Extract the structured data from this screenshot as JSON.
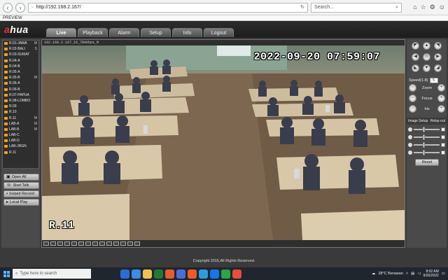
{
  "browser": {
    "url": "http://192.168.2.167/",
    "search_placeholder": "Search...",
    "tab_title": "PREVIEW"
  },
  "app": {
    "logo_prefix": "a",
    "logo_main": "hua",
    "tabs": [
      {
        "label": "Live",
        "active": true
      },
      {
        "label": "Playback",
        "active": false
      },
      {
        "label": "Alarm",
        "active": false
      },
      {
        "label": "Setup",
        "active": false
      },
      {
        "label": "Info",
        "active": false
      },
      {
        "label": "Logout",
        "active": false
      }
    ]
  },
  "sidebar": {
    "cameras": [
      {
        "label": "R.01-JAWA",
        "mark": "M"
      },
      {
        "label": "R.02-BALI",
        "mark": "S"
      },
      {
        "label": "R.03-SUMAT",
        "mark": ""
      },
      {
        "label": "R.04-A",
        "mark": ""
      },
      {
        "label": "R.04-B",
        "mark": ""
      },
      {
        "label": "R.05-A",
        "mark": ""
      },
      {
        "label": "R.05-B",
        "mark": "M"
      },
      {
        "label": "R.06-A",
        "mark": ""
      },
      {
        "label": "R.06-B",
        "mark": ""
      },
      {
        "label": "R.07-PAPUA",
        "mark": ""
      },
      {
        "label": "R.08-LOMBO",
        "mark": ""
      },
      {
        "label": "R.09",
        "mark": ""
      },
      {
        "label": "R.10",
        "mark": ""
      },
      {
        "label": "R.11",
        "mark": "M"
      },
      {
        "label": "LAB-A",
        "mark": "M"
      },
      {
        "label": "LAB-B",
        "mark": "M"
      },
      {
        "label": "LAB-C",
        "mark": ""
      },
      {
        "label": "LAB-D",
        "mark": ""
      },
      {
        "label": "LAB-JRGN",
        "mark": ""
      },
      {
        "label": "R.11",
        "mark": ""
      }
    ],
    "buttons": {
      "open_all": "Open All",
      "start_talk": "Start Talk",
      "instant_record": "Instant Record",
      "local_play": "Local Play"
    }
  },
  "video": {
    "titlebar": "192.168.2.167_16_7RAKbps_M",
    "timestamp": "2022-09-20 07:59:07",
    "channel_name": "R.11"
  },
  "ptz": {
    "speed_label": "Speed(1-8)",
    "speed_value": "5",
    "zoom_label": "Zoom",
    "focus_label": "Focus",
    "iris_label": "Iris",
    "image_setup_label": "Image Setup",
    "relay_out_label": "Relay-out",
    "reset_label": "Reset",
    "sliders": [
      {
        "icon": "brightness-icon",
        "level": 0.35
      },
      {
        "icon": "contrast-icon",
        "level": 0.35
      },
      {
        "icon": "saturation-icon",
        "level": 0.35
      },
      {
        "icon": "hue-icon",
        "level": 0.35
      }
    ]
  },
  "footer": {
    "copyright": "Copyright 2015,All Rights Reserved."
  },
  "taskbar": {
    "search_placeholder": "Type here to search",
    "weather": "28°C  Berawan",
    "time": "8:02 AM",
    "date": "9/20/2022",
    "app_colors": [
      "#2b6cd8",
      "#3a8ee6",
      "#f2c14e",
      "#1f7a3a",
      "#e85c2c",
      "#4a6ed8",
      "#f05a28",
      "#2d9cdb",
      "#1a73e8",
      "#28a745",
      "#e74c3c"
    ]
  }
}
